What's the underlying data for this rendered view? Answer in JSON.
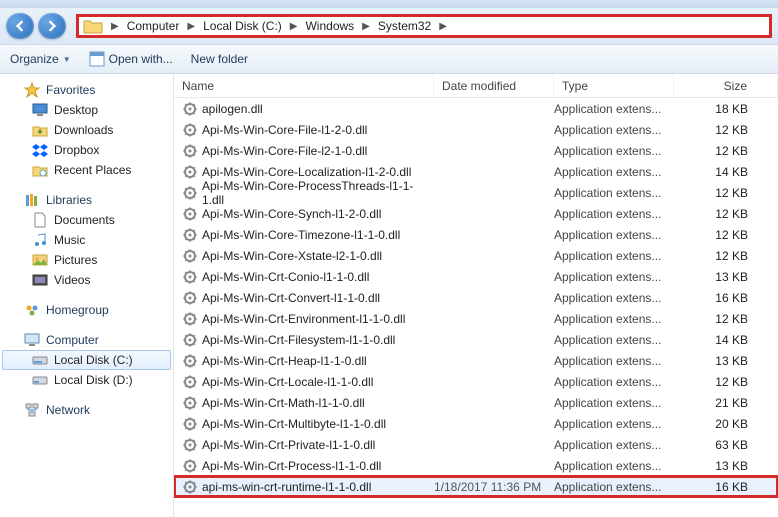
{
  "breadcrumb": {
    "items": [
      "Computer",
      "Local Disk (C:)",
      "Windows",
      "System32"
    ]
  },
  "toolbar": {
    "organize": "Organize",
    "openwith": "Open with...",
    "newfolder": "New folder"
  },
  "sidebar": {
    "favorites": {
      "label": "Favorites",
      "items": [
        "Desktop",
        "Downloads",
        "Dropbox",
        "Recent Places"
      ]
    },
    "libraries": {
      "label": "Libraries",
      "items": [
        "Documents",
        "Music",
        "Pictures",
        "Videos"
      ]
    },
    "homegroup": {
      "label": "Homegroup"
    },
    "computer": {
      "label": "Computer",
      "items": [
        "Local Disk (C:)",
        "Local Disk (D:)"
      ]
    },
    "network": {
      "label": "Network"
    }
  },
  "columns": {
    "name": "Name",
    "date": "Date modified",
    "type": "Type",
    "size": "Size"
  },
  "files": [
    {
      "name": "apilogen.dll",
      "type": "Application extens...",
      "size": "18 KB"
    },
    {
      "name": "Api-Ms-Win-Core-File-l1-2-0.dll",
      "type": "Application extens...",
      "size": "12 KB"
    },
    {
      "name": "Api-Ms-Win-Core-File-l2-1-0.dll",
      "type": "Application extens...",
      "size": "12 KB"
    },
    {
      "name": "Api-Ms-Win-Core-Localization-l1-2-0.dll",
      "type": "Application extens...",
      "size": "14 KB"
    },
    {
      "name": "Api-Ms-Win-Core-ProcessThreads-l1-1-1.dll",
      "type": "Application extens...",
      "size": "12 KB"
    },
    {
      "name": "Api-Ms-Win-Core-Synch-l1-2-0.dll",
      "type": "Application extens...",
      "size": "12 KB"
    },
    {
      "name": "Api-Ms-Win-Core-Timezone-l1-1-0.dll",
      "type": "Application extens...",
      "size": "12 KB"
    },
    {
      "name": "Api-Ms-Win-Core-Xstate-l2-1-0.dll",
      "type": "Application extens...",
      "size": "12 KB"
    },
    {
      "name": "Api-Ms-Win-Crt-Conio-l1-1-0.dll",
      "type": "Application extens...",
      "size": "13 KB"
    },
    {
      "name": "Api-Ms-Win-Crt-Convert-l1-1-0.dll",
      "type": "Application extens...",
      "size": "16 KB"
    },
    {
      "name": "Api-Ms-Win-Crt-Environment-l1-1-0.dll",
      "type": "Application extens...",
      "size": "12 KB"
    },
    {
      "name": "Api-Ms-Win-Crt-Filesystem-l1-1-0.dll",
      "type": "Application extens...",
      "size": "14 KB"
    },
    {
      "name": "Api-Ms-Win-Crt-Heap-l1-1-0.dll",
      "type": "Application extens...",
      "size": "13 KB"
    },
    {
      "name": "Api-Ms-Win-Crt-Locale-l1-1-0.dll",
      "type": "Application extens...",
      "size": "12 KB"
    },
    {
      "name": "Api-Ms-Win-Crt-Math-l1-1-0.dll",
      "type": "Application extens...",
      "size": "21 KB"
    },
    {
      "name": "Api-Ms-Win-Crt-Multibyte-l1-1-0.dll",
      "type": "Application extens...",
      "size": "20 KB"
    },
    {
      "name": "Api-Ms-Win-Crt-Private-l1-1-0.dll",
      "type": "Application extens...",
      "size": "63 KB"
    },
    {
      "name": "Api-Ms-Win-Crt-Process-l1-1-0.dll",
      "type": "Application extens...",
      "size": "13 KB"
    },
    {
      "name": "api-ms-win-crt-runtime-l1-1-0.dll",
      "date": "1/18/2017 11:36 PM",
      "type": "Application extens...",
      "size": "16 KB",
      "hl": true
    }
  ]
}
